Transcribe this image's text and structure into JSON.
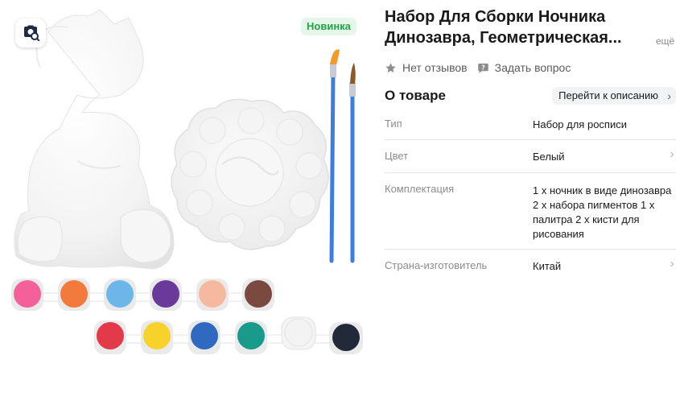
{
  "gallery": {
    "badge": "Новинка"
  },
  "product": {
    "title_line1": "Набор Для Сборки Ночника",
    "title_line2": "Динозавра, Геометрическая...",
    "more_link": "ещё"
  },
  "meta": {
    "reviews_label": "Нет отзывов",
    "question_label": "Задать вопрос"
  },
  "about": {
    "title": "О товаре",
    "goto_description": "Перейти к описанию"
  },
  "specs": [
    {
      "key": "Тип",
      "value": "Набор для росписи"
    },
    {
      "key": "Цвет",
      "value": "Белый"
    },
    {
      "key": "Комплектация",
      "value": "1 х ночник в виде динозавра 2 х набора пигментов 1 х палитра 2 х кисти для рисования"
    },
    {
      "key": "Страна-изготовитель",
      "value": "Китай"
    }
  ],
  "paint_colors_row1": [
    "#f4609a",
    "#f27a3c",
    "#6cb6ea",
    "#6a3a9a",
    "#f7b8a0",
    "#7a4a40"
  ],
  "paint_colors_row2": [
    "#e23a4a",
    "#f6d22a",
    "#2f6ac0",
    "#199a8a",
    "#f3f3f3",
    "#222a3a"
  ]
}
